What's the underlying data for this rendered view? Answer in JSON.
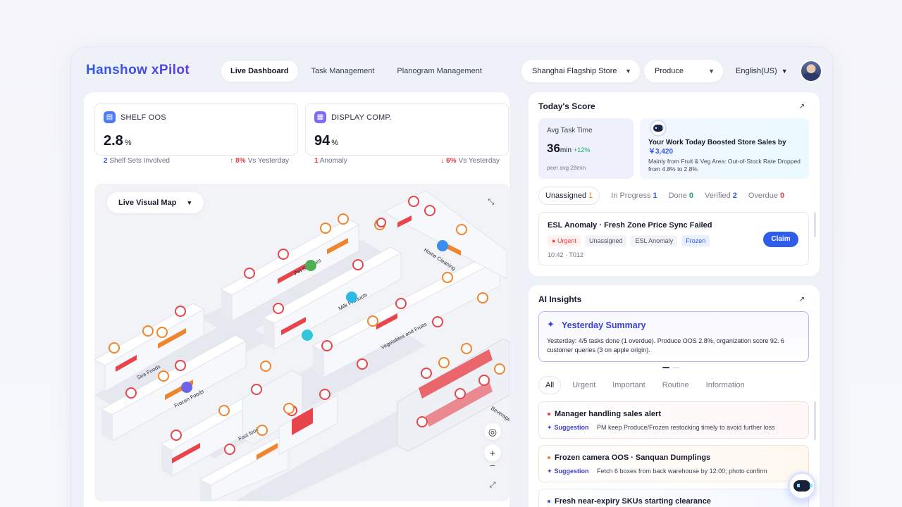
{
  "app": {
    "logo": "Hanshow xPilot"
  },
  "nav": {
    "tabs": [
      "Live Dashboard",
      "Task Management",
      "Planogram Management"
    ],
    "active": 0
  },
  "header": {
    "store": "Shanghai Flagship Store",
    "category": "Produce",
    "language": "English(US)"
  },
  "kpis": {
    "shelf_oos": {
      "label": "SHELF OOS",
      "value": "2.8",
      "unit": "%",
      "count": "2",
      "count_text": "Shelf Sets Involved",
      "delta": "8%",
      "delta_text": "Vs Yesterday"
    },
    "display": {
      "label": "DISPLAY COMP.",
      "value": "94",
      "unit": "%",
      "count": "1",
      "count_text": "Anomaly",
      "delta": "6%",
      "delta_text": "Vs Yesterday"
    }
  },
  "map": {
    "view": "Live Visual Map",
    "zones": [
      "Pet Supplies",
      "Home Cleaning",
      "Milk Products",
      "Sea Foods",
      "Frozen Foods",
      "Vegetables and Fruits",
      "Fast food",
      "Beverages"
    ]
  },
  "score": {
    "title": "Today's Score",
    "avg_label": "Avg Task Time",
    "avg_value": "36",
    "avg_unit": "min",
    "avg_change": "+12%",
    "peer": "peer avg 28min",
    "boost_title": "Your Work Today Boosted Store Sales by",
    "boost_amount": "￥3,420",
    "boost_detail": "Mainly from Fruit & Veg Area: Out-of-Stock Rate Dropped from 4.8% to 2.8%"
  },
  "task_status": [
    {
      "label": "Unassigned",
      "count": "1",
      "color": "#f07d2a"
    },
    {
      "label": "In Progress",
      "count": "1",
      "color": "#3557e5"
    },
    {
      "label": "Done",
      "count": "0",
      "color": "#20a86b"
    },
    {
      "label": "Verified",
      "count": "2",
      "color": "#3557e5"
    },
    {
      "label": "Overdue",
      "count": "0",
      "color": "#ea3f3f"
    }
  ],
  "task": {
    "title": "ESL Anomaly · Fresh Zone Price Sync Failed",
    "tags": [
      "Urgent",
      "Unassigned",
      "ESL Anomaly",
      "Frozen"
    ],
    "time": "10:42 · T012",
    "action": "Claim"
  },
  "ai": {
    "title": "AI Insights",
    "summary_title": "Yesterday Summary",
    "summary_body": "Yesterday: 4/5 tasks done (1 overdue). Produce OOS 2.8%, organization score 92. 6 customer queries (3 on apple origin).",
    "filters": [
      "All",
      "Urgent",
      "Important",
      "Routine",
      "Information"
    ],
    "items": [
      {
        "title": "Manager handling sales alert",
        "tag": "Suggestion",
        "text": "PM keep Produce/Frozen restocking timely to avoid further loss",
        "color": "#ea3f3f"
      },
      {
        "title": "Frozen camera OOS · Sanquan Dumplings",
        "tag": "Suggestion",
        "text": "Fetch 6 boxes from back warehouse by 12:00; photo confirm",
        "color": "#f07d2a"
      },
      {
        "title": "Fresh near-expiry SKUs starting clearance",
        "tag": "",
        "text": "",
        "color": "#3557e5"
      }
    ]
  },
  "colors": {
    "primary": "#2f5ce8",
    "oos_red": "#e8444b",
    "warn_orange": "#f0852e"
  }
}
